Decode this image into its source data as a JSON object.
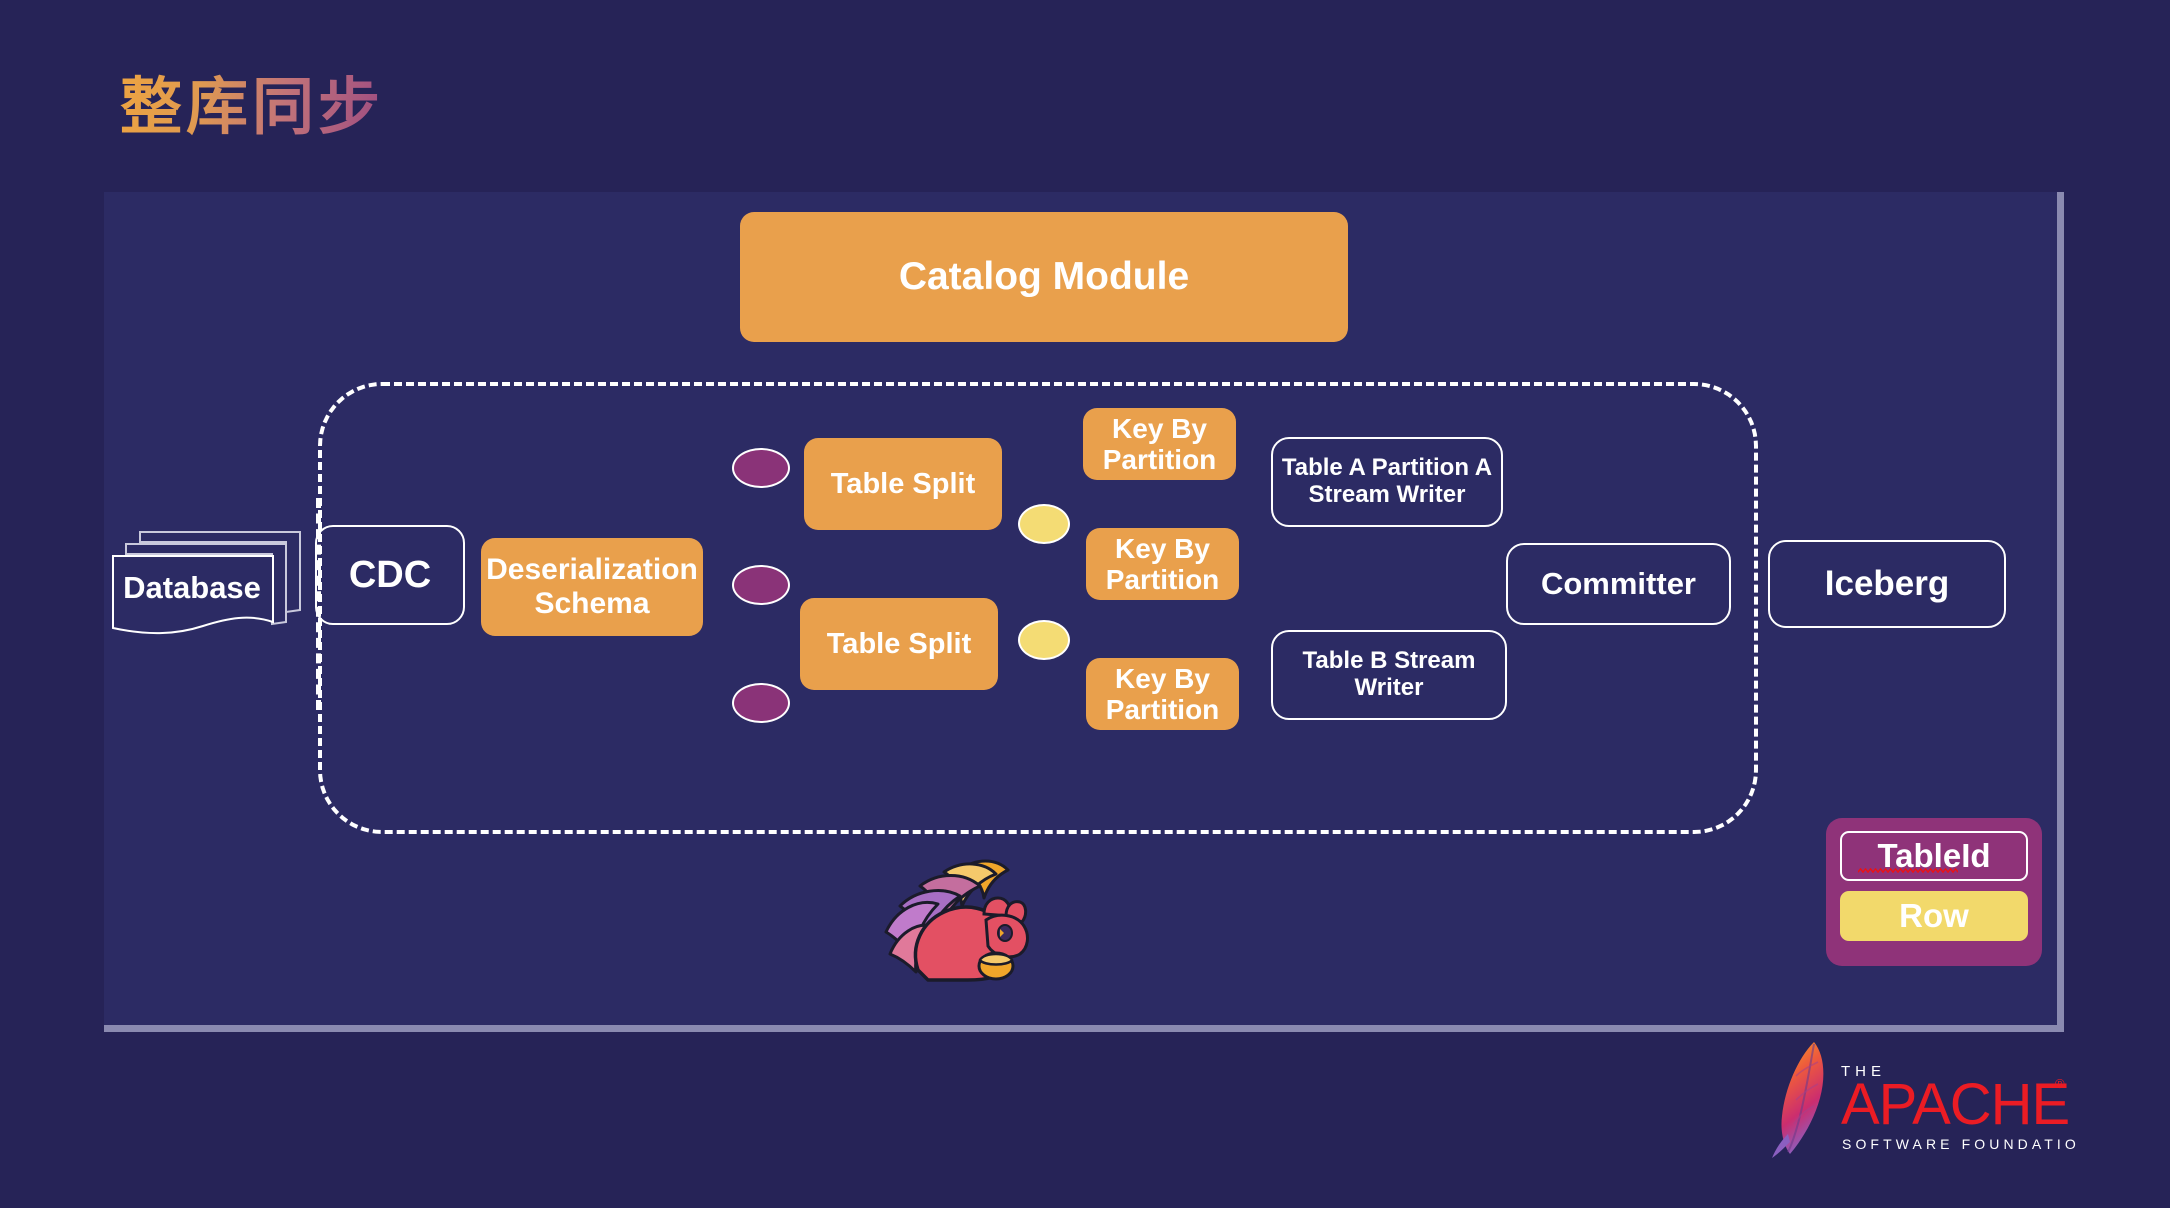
{
  "slide": {
    "title": "整库同步",
    "background_color": "#262357",
    "panel_color": "#2C2B64",
    "panel_border_color": "#8A8AB0",
    "accent_orange": "#E9A04C",
    "accent_purple": "#8A3378",
    "accent_yellow": "#F4DC74",
    "title_gradient_from": "#EDA441",
    "title_gradient_to": "#9E4C82"
  },
  "diagram": {
    "catalog_module": {
      "label": "Catalog Module"
    },
    "source": {
      "database": {
        "label": "Database",
        "icon": "stacked-documents-icon"
      },
      "cdc": {
        "label": "CDC"
      }
    },
    "deserialization_schema": {
      "label": "Deserialization Schema"
    },
    "table_splits": [
      {
        "label": "Table Split"
      },
      {
        "label": "Table Split"
      }
    ],
    "key_by_partitions": [
      {
        "label": "Key By Partition"
      },
      {
        "label": "Key By Partition"
      },
      {
        "label": "Key By Partition"
      }
    ],
    "writers": [
      {
        "label": "Table A Partition A Stream Writer"
      },
      {
        "label": "Table B Stream Writer"
      }
    ],
    "committer": {
      "label": "Committer"
    },
    "sink": {
      "label": "Iceberg"
    },
    "input_ellipses": [
      {
        "kind": "tableid-record"
      },
      {
        "kind": "tableid-record"
      },
      {
        "kind": "tableid-record"
      }
    ],
    "row_ellipses": [
      {
        "kind": "row-record"
      },
      {
        "kind": "row-record"
      }
    ]
  },
  "legend": {
    "tableid_label": "TableId",
    "row_label": "Row",
    "tableid_has_spellcheck_underline": true
  },
  "branding": {
    "flink_mascot": "flink-squirrel-logo",
    "apache": {
      "the": "THE",
      "name": "APACHE",
      "tagline": "SOFTWARE FOUNDATION",
      "registered_mark": "®",
      "name_color": "#EB1C24"
    }
  }
}
